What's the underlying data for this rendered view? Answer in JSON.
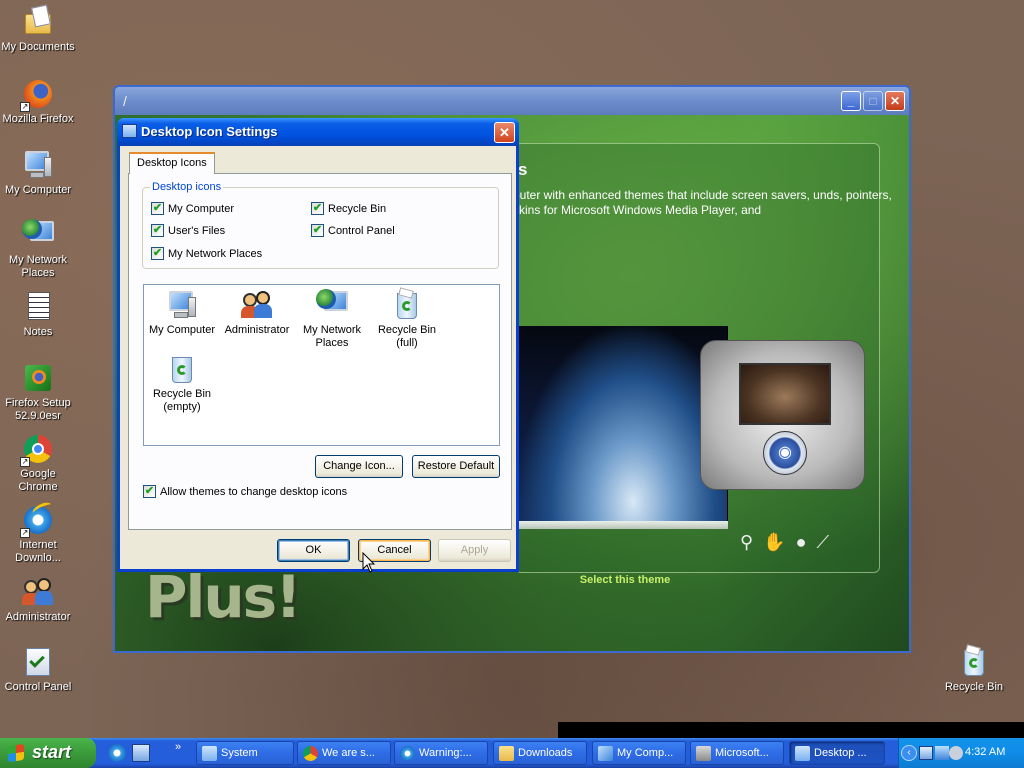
{
  "desktop": {
    "icons": [
      {
        "label": "My Documents"
      },
      {
        "label": "Mozilla Firefox"
      },
      {
        "label": "My Computer"
      },
      {
        "label": "My Network Places"
      },
      {
        "label": "Notes"
      },
      {
        "label": "Firefox Setup 52.9.0esr"
      },
      {
        "label": "Google Chrome"
      },
      {
        "label": "Internet Downlo..."
      },
      {
        "label": "Administrator"
      },
      {
        "label": "Control Panel"
      },
      {
        "label": "Recycle Bin"
      }
    ]
  },
  "theme_window": {
    "heading_fragment": "s",
    "description": "puter with enhanced themes that include screen savers, unds, pointers, skins for Microsoft Windows Media Player, and",
    "select_link": "Select this theme",
    "logo_text": "Plus!"
  },
  "dialog": {
    "title": "Desktop Icon Settings",
    "tab_label": "Desktop Icons",
    "group_legend": "Desktop icons",
    "checkboxes": [
      {
        "label": "My Computer",
        "checked": true
      },
      {
        "label": "Recycle Bin",
        "checked": true
      },
      {
        "label": "User's Files",
        "checked": true
      },
      {
        "label": "Control Panel",
        "checked": true
      },
      {
        "label": "My Network Places",
        "checked": true
      }
    ],
    "icon_list": [
      {
        "label": "My Computer"
      },
      {
        "label": "Administrator"
      },
      {
        "label": "My Network Places"
      },
      {
        "label": "Recycle Bin (full)"
      },
      {
        "label": "Recycle Bin (empty)"
      }
    ],
    "change_icon_label": "Change Icon...",
    "restore_default_label": "Restore Default",
    "allow_themes_label": "Allow themes to change desktop icons",
    "allow_themes_checked": true,
    "ok_label": "OK",
    "cancel_label": "Cancel",
    "apply_label": "Apply",
    "check_glyph": "✔"
  },
  "taskbar": {
    "start_label": "start",
    "quick_more": "»",
    "tasks": [
      {
        "label": "System"
      },
      {
        "label": "We are s..."
      },
      {
        "label": "Warning:..."
      },
      {
        "label": "Downloads"
      },
      {
        "label": "My Comp..."
      },
      {
        "label": "Microsoft..."
      },
      {
        "label": "Desktop ..."
      }
    ],
    "tray_expand": "‹",
    "clock": "4:32 AM"
  },
  "colors": {
    "xp_blue": "#0052e0",
    "start_green": "#3b9b3b",
    "theme_green": "#4c9a3a"
  }
}
